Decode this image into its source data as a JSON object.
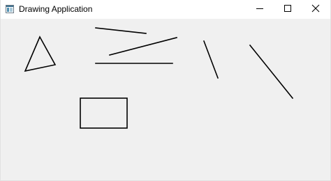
{
  "window": {
    "title": "Drawing Application",
    "app_icon": "app-window-icon",
    "controls": {
      "minimize_icon": "minimize-icon",
      "maximize_icon": "maximize-icon",
      "close_icon": "close-icon"
    }
  },
  "canvas": {
    "background": "#f0f0f0",
    "stroke_color": "#000000",
    "shapes": [
      {
        "type": "triangle",
        "name": "drawn-triangle"
      },
      {
        "type": "line",
        "name": "drawn-line-1"
      },
      {
        "type": "line",
        "name": "drawn-line-2"
      },
      {
        "type": "line",
        "name": "drawn-line-3"
      },
      {
        "type": "line",
        "name": "drawn-line-4"
      },
      {
        "type": "line",
        "name": "drawn-line-5"
      },
      {
        "type": "rectangle",
        "name": "drawn-rectangle"
      }
    ]
  }
}
